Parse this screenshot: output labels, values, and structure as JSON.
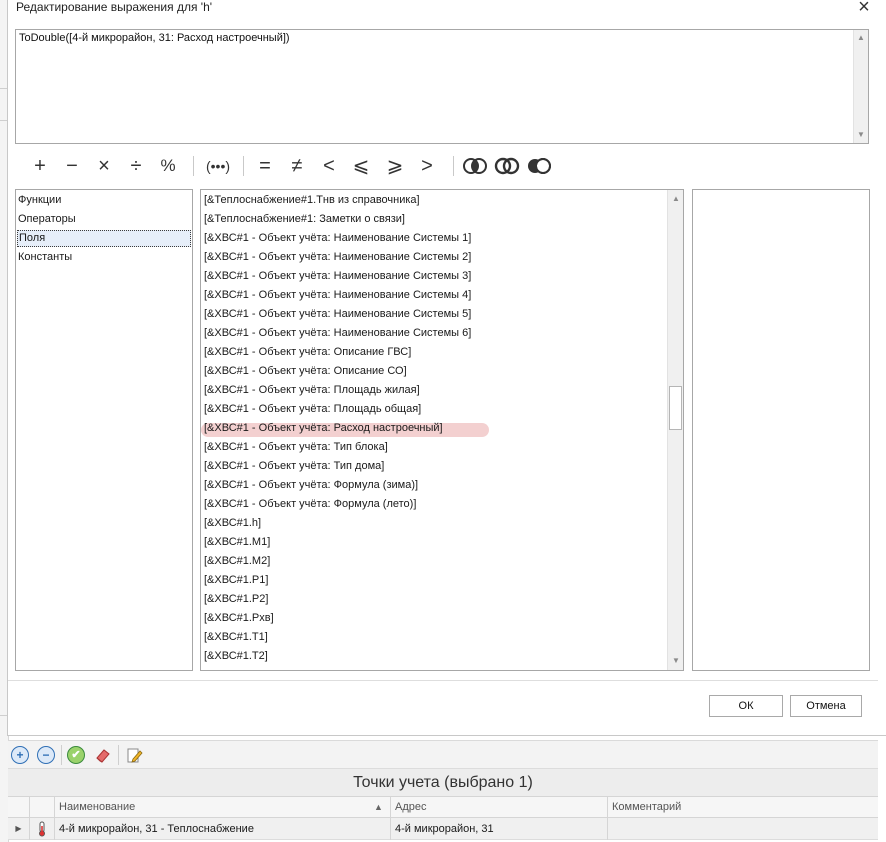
{
  "window": {
    "title": "Редактирование выражения для 'h'"
  },
  "expression": {
    "value": "ToDouble([4-й микрорайон, 31: Расход настроечный])"
  },
  "toolbar": {
    "operators": [
      "+",
      "−",
      "×",
      "÷",
      "%",
      "(•••)",
      "=",
      "≠",
      "<",
      "⩽",
      "⩾",
      ">"
    ]
  },
  "categories": {
    "items": [
      "Функции",
      "Операторы",
      "Поля",
      "Константы"
    ],
    "selected": "Поля"
  },
  "fields": {
    "items": [
      "[&Теплоснабжение#1.Тнв из справочника]",
      "[&Теплоснабжение#1: Заметки о связи]",
      "[&ХВС#1 - Объект учёта: Наименование Системы 1]",
      "[&ХВС#1 - Объект учёта: Наименование Системы 2]",
      "[&ХВС#1 - Объект учёта: Наименование Системы 3]",
      "[&ХВС#1 - Объект учёта: Наименование Системы 4]",
      "[&ХВС#1 - Объект учёта: Наименование Системы 5]",
      "[&ХВС#1 - Объект учёта: Наименование Системы 6]",
      "[&ХВС#1 - Объект учёта: Описание ГВС]",
      "[&ХВС#1 - Объект учёта: Описание СО]",
      "[&ХВС#1 - Объект учёта: Площадь жилая]",
      "[&ХВС#1 - Объект учёта: Площадь общая]",
      "[&ХВС#1 - Объект учёта: Расход настроечный]",
      "[&ХВС#1 - Объект учёта: Тип блока]",
      "[&ХВС#1 - Объект учёта: Тип дома]",
      "[&ХВС#1 - Объект учёта: Формула (зима)]",
      "[&ХВС#1 - Объект учёта: Формула (лето)]",
      "[&ХВС#1.h]",
      "[&ХВС#1.M1]",
      "[&ХВС#1.M2]",
      "[&ХВС#1.P1]",
      "[&ХВС#1.P2]",
      "[&ХВС#1.Pхв]",
      "[&ХВС#1.T1]",
      "[&ХВС#1.T2]"
    ],
    "highlighted": "[&ХВС#1 - Объект учёта: Расход настроечный]"
  },
  "buttons": {
    "ok": "ОК",
    "cancel": "Отмена"
  },
  "grid": {
    "title": "Точки учета (выбрано 1)",
    "columns": [
      "Наименование",
      "Адрес",
      "Комментарий"
    ],
    "rows": [
      {
        "name": "4-й микрорайон, 31 - Теплоснабжение",
        "address": "4-й микрорайон, 31",
        "comment": ""
      }
    ]
  },
  "colors": {
    "highlight": "#e9a8a8",
    "selection": "#e6eef9",
    "add": "#2f7fd0",
    "ok": "#3ea043"
  }
}
